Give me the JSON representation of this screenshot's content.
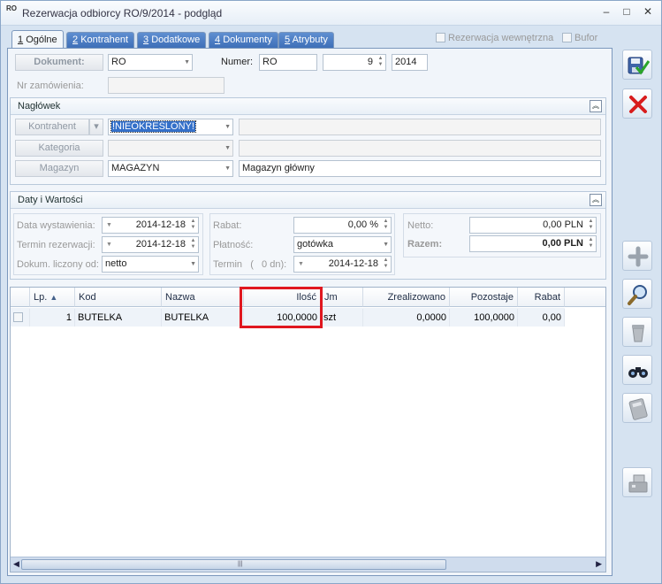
{
  "window": {
    "app_icon": "RO",
    "title": "Rezerwacja odbiorcy RO/9/2014 - podgląd",
    "controls": {
      "minimize": "–",
      "maximize": "□",
      "close": "✕"
    }
  },
  "tabs": [
    {
      "num": "1",
      "label": "Ogólne",
      "active": true
    },
    {
      "num": "2",
      "label": "Kontrahent",
      "active": false
    },
    {
      "num": "3",
      "label": "Dodatkowe",
      "active": false
    },
    {
      "num": "4",
      "label": "Dokumenty",
      "active": false
    },
    {
      "num": "5",
      "label": "Atrybuty",
      "active": false
    }
  ],
  "top_checkboxes": {
    "internal": "Rezerwacja wewnętrzna",
    "buffer": "Bufor"
  },
  "document": {
    "button_label": "Dokument:",
    "type_value": "RO",
    "number_label": "Numer:",
    "number_prefix": "RO",
    "number_value": "9",
    "number_year": "2014",
    "order_no_label": "Nr zamówienia:",
    "order_no_value": ""
  },
  "naglowek": {
    "title": "Nagłówek",
    "kontrahent_label": "Kontrahent",
    "kontrahent_value": "!NIEOKREŚLONY!",
    "kontrahent_name": "",
    "kategoria_label": "Kategoria",
    "kategoria_value": "",
    "kategoria_desc": "",
    "magazyn_label": "Magazyn",
    "magazyn_value": "MAGAZYN",
    "magazyn_desc": "Magazyn główny"
  },
  "daty": {
    "title": "Daty i Wartości",
    "issue_date_label": "Data wystawienia:",
    "issue_date": "2014-12-18",
    "reservation_label": "Termin rezerwacji:",
    "reservation_date": "2014-12-18",
    "computed_from_label": "Dokum. liczony od:",
    "computed_from": "netto",
    "rabat_label": "Rabat:",
    "rabat_value": "0,00 %",
    "payment_label": "Płatność:",
    "payment_value": "gotówka",
    "term_label": "Termin",
    "term_open": "(",
    "term_days": "0 dn):",
    "term_date": "2014-12-18",
    "netto_label": "Netto:",
    "netto_value": "0,00 PLN",
    "razem_label": "Razem:",
    "razem_value": "0,00 PLN"
  },
  "grid": {
    "columns": [
      "Lp.",
      "Kod",
      "Nazwa",
      "Ilość",
      "Jm",
      "Zrealizowano",
      "Pozostaje",
      "Rabat"
    ],
    "sort_indicator": "▲",
    "rows": [
      {
        "lp": "1",
        "kod": "BUTELKA",
        "nazwa": "BUTELKA",
        "ilosc": "100,0000",
        "jm": "szt",
        "zrealizowano": "0,0000",
        "pozostaje": "100,0000",
        "rabat": "0,00"
      }
    ]
  },
  "side_buttons": [
    {
      "name": "save-icon",
      "enabled": true
    },
    {
      "name": "cancel-icon",
      "enabled": true
    },
    {
      "name": "add-icon",
      "enabled": false
    },
    {
      "name": "preview-icon",
      "enabled": true
    },
    {
      "name": "delete-icon",
      "enabled": false
    },
    {
      "name": "binoculars-icon",
      "enabled": true
    },
    {
      "name": "calculator-icon",
      "enabled": false
    },
    {
      "name": "cash-register-icon",
      "enabled": false
    }
  ],
  "colors": {
    "highlight": "#e0171f",
    "tab_inactive": "#4a7cc3",
    "cancel_red": "#d81c1c"
  }
}
